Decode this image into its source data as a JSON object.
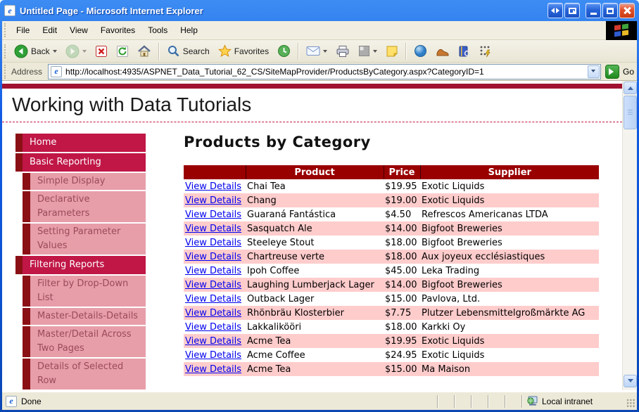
{
  "window": {
    "title": "Untitled Page - Microsoft Internet Explorer"
  },
  "menu": {
    "items": [
      "File",
      "Edit",
      "View",
      "Favorites",
      "Tools",
      "Help"
    ]
  },
  "toolbar": {
    "back_label": "Back",
    "search_label": "Search",
    "favorites_label": "Favorites"
  },
  "address": {
    "label": "Address",
    "url": "http://localhost:4935/ASPNET_Data_Tutorial_62_CS/SiteMapProvider/ProductsByCategory.aspx?CategoryID=1",
    "go_label": "Go"
  },
  "page": {
    "site_title": "Working with Data Tutorials",
    "heading": "Products by Category",
    "nav": [
      {
        "label": "Home",
        "level": 0
      },
      {
        "label": "Basic Reporting",
        "level": 0
      },
      {
        "label": "Simple Display",
        "level": 1
      },
      {
        "label": "Declarative Parameters",
        "level": 1
      },
      {
        "label": "Setting Parameter Values",
        "level": 1
      },
      {
        "label": "Filtering Reports",
        "level": 0
      },
      {
        "label": "Filter by Drop-Down List",
        "level": 1
      },
      {
        "label": "Master-Details-Details",
        "level": 1
      },
      {
        "label": "Master/Detail Across Two Pages",
        "level": 1
      },
      {
        "label": "Details of Selected Row",
        "level": 1
      }
    ],
    "table": {
      "headers": [
        "",
        "Product",
        "Price",
        "Supplier"
      ],
      "link_label": "View Details",
      "rows": [
        {
          "product": "Chai Tea",
          "price": "$19.95",
          "supplier": "Exotic Liquids"
        },
        {
          "product": "Chang",
          "price": "$19.00",
          "supplier": "Exotic Liquids"
        },
        {
          "product": "Guaraná Fantástica",
          "price": "$4.50",
          "supplier": "Refrescos Americanas LTDA"
        },
        {
          "product": "Sasquatch Ale",
          "price": "$14.00",
          "supplier": "Bigfoot Breweries"
        },
        {
          "product": "Steeleye Stout",
          "price": "$18.00",
          "supplier": "Bigfoot Breweries"
        },
        {
          "product": "Chartreuse verte",
          "price": "$18.00",
          "supplier": "Aux joyeux ecclésiastiques"
        },
        {
          "product": "Ipoh Coffee",
          "price": "$45.00",
          "supplier": "Leka Trading"
        },
        {
          "product": "Laughing Lumberjack Lager",
          "price": "$14.00",
          "supplier": "Bigfoot Breweries"
        },
        {
          "product": "Outback Lager",
          "price": "$15.00",
          "supplier": "Pavlova, Ltd."
        },
        {
          "product": "Rhönbräu Klosterbier",
          "price": "$7.75",
          "supplier": "Plutzer Lebensmittelgroßmärkte AG"
        },
        {
          "product": "Lakkalikööri",
          "price": "$18.00",
          "supplier": "Karkki Oy"
        },
        {
          "product": "Acme Tea",
          "price": "$19.95",
          "supplier": "Exotic Liquids"
        },
        {
          "product": "Acme Coffee",
          "price": "$24.95",
          "supplier": "Exotic Liquids"
        },
        {
          "product": "Acme Tea",
          "price": "$15.00",
          "supplier": "Ma Maison"
        }
      ]
    }
  },
  "status": {
    "left": "Done",
    "zone": "Local intranet"
  },
  "colors": {
    "titlebar_blue": "#115BE4",
    "chrome_tan": "#ECE9D8",
    "nav_crimson": "#C01747",
    "nav_dark": "#8B1016",
    "nav_pink": "#E79EA9",
    "table_header_red": "#990000",
    "alt_row_pink": "#FFCCCC",
    "link_blue": "#0000EE",
    "top_bar_red": "#A01230"
  }
}
